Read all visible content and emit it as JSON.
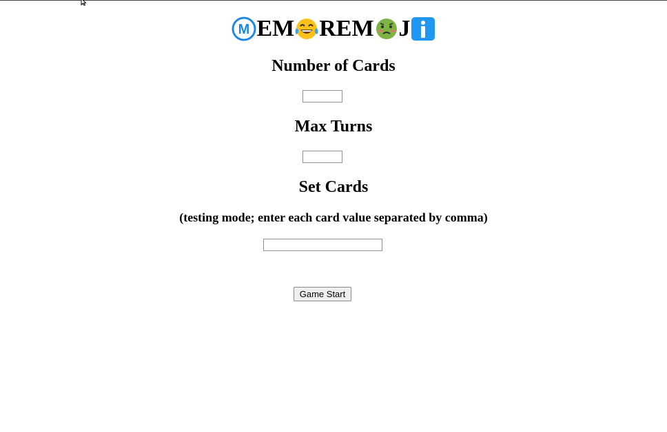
{
  "title": {
    "parts": [
      {
        "kind": "emoji",
        "icon": "m-circle-icon"
      },
      {
        "kind": "text",
        "text": "EM"
      },
      {
        "kind": "emoji",
        "icon": "tears-of-joy-icon"
      },
      {
        "kind": "text",
        "text": "REM"
      },
      {
        "kind": "emoji",
        "icon": "nauseated-face-icon"
      },
      {
        "kind": "text",
        "text": "J"
      },
      {
        "kind": "emoji",
        "icon": "information-icon"
      }
    ]
  },
  "form": {
    "num_cards_label": "Number of Cards",
    "num_cards_value": "",
    "max_turns_label": "Max Turns",
    "max_turns_value": "",
    "set_cards_label": "Set Cards",
    "set_cards_hint": "(testing mode; enter each card value separated by comma)",
    "set_cards_value": "",
    "start_button_label": "Game Start"
  },
  "colors": {
    "m_circle": "#1e88e5",
    "info_box": "#2196f3",
    "emoji_yellow": "#fcc21b",
    "nauseated_green": "#7cb342"
  }
}
